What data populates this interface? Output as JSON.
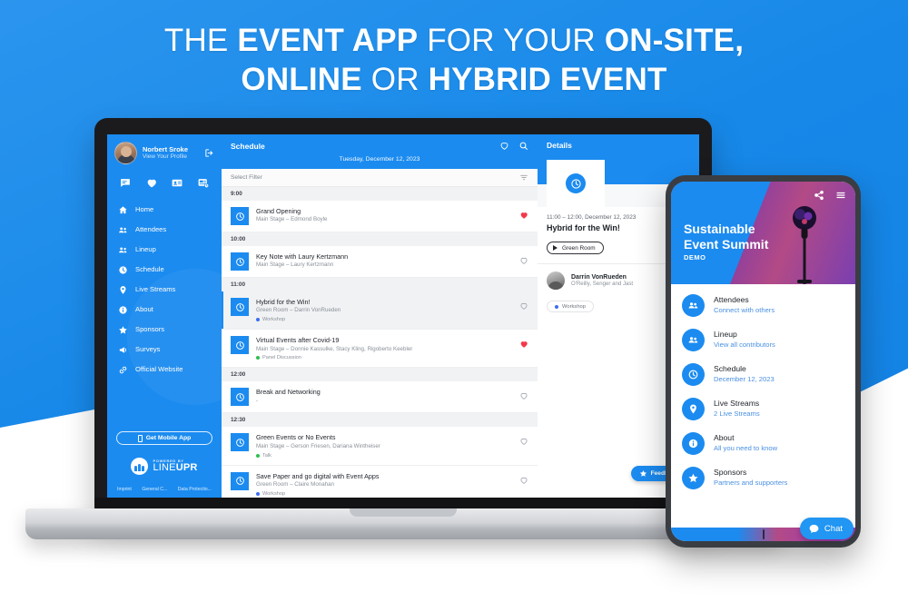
{
  "headline": {
    "line1_a": "THE ",
    "line1_b": "EVENT APP",
    "line1_c": " FOR YOUR ",
    "line1_d": "ON-SITE,",
    "line2_a": "ONLINE",
    "line2_b": " OR ",
    "line2_c": "HYBRID EVENT"
  },
  "colors": {
    "brand_blue": "#1b8bf0",
    "background_blue": "#1788e8",
    "heart_red": "#f3384a",
    "tag_blue": "#3d6ef0",
    "tag_green": "#2fbf4f",
    "link_blue": "#4a90e2"
  },
  "laptop": {
    "sidebar": {
      "profile": {
        "name": "Norbert Sroke",
        "subtitle": "View Your Profile",
        "logout_icon": "logout-icon",
        "avatar_icon": "avatar"
      },
      "quick_icons": [
        "chat-icon",
        "heart-icon",
        "contact-card-icon",
        "news-calendar-icon"
      ],
      "items": [
        {
          "label": "Home",
          "icon": "home-icon"
        },
        {
          "label": "Attendees",
          "icon": "people-icon"
        },
        {
          "label": "Lineup",
          "icon": "people-icon"
        },
        {
          "label": "Schedule",
          "icon": "clock-icon"
        },
        {
          "label": "Live Streams",
          "icon": "pin-icon"
        },
        {
          "label": "About",
          "icon": "info-icon"
        },
        {
          "label": "Sponsors",
          "icon": "star-icon"
        },
        {
          "label": "Surveys",
          "icon": "megaphone-icon"
        },
        {
          "label": "Official Website",
          "icon": "link-icon"
        }
      ],
      "mobile_app_button": "Get Mobile App",
      "brand": {
        "powered_by": "POWERED BY",
        "name_light": "LINE",
        "name_bold": "UPR"
      },
      "footer_links": [
        "Imprint",
        "General C...",
        "Data Protectio..."
      ]
    },
    "schedule": {
      "title": "Schedule",
      "header_icons": [
        "heart-icon",
        "search-icon"
      ],
      "date": "Tuesday, December 12, 2023",
      "filter_placeholder": "Select Filter",
      "filter_icon": "filter-icon",
      "groups": [
        {
          "time": "9:00",
          "events": [
            {
              "title": "Grand Opening",
              "meta": "Main Stage – Edmond Boyle",
              "tag": "",
              "tag_color": "",
              "favorited": true,
              "selected": false
            }
          ]
        },
        {
          "time": "10:00",
          "events": [
            {
              "title": "Key Note with Laury Kertzmann",
              "meta": "Main Stage – Laury Kertzmann",
              "tag": "",
              "tag_color": "",
              "favorited": false,
              "selected": false
            }
          ]
        },
        {
          "time": "11:00",
          "events": [
            {
              "title": "Hybrid for the Win!",
              "meta": "Green Room – Darrin VonRueden",
              "tag": "Workshop",
              "tag_color": "#3d6ef0",
              "favorited": false,
              "selected": true
            },
            {
              "title": "Virtual Events after Covid-19",
              "meta": "Main Stage – Donnie Kassulke, Stacy Kling, Rigoberto Keebler",
              "tag": "Panel Discussion",
              "tag_color": "#2fbf4f",
              "favorited": true,
              "selected": false
            }
          ]
        },
        {
          "time": "12:00",
          "events": [
            {
              "title": "Break and Networking",
              "meta": "-",
              "tag": "",
              "tag_color": "",
              "favorited": false,
              "selected": false
            }
          ]
        },
        {
          "time": "12:30",
          "events": [
            {
              "title": "Green Events or No Events",
              "meta": "Main Stage – Gerson Friesen, Dariana Wintheiser",
              "tag": "Talk",
              "tag_color": "#2fbf4f",
              "favorited": false,
              "selected": false
            },
            {
              "title": "Save Paper and go digital with Event Apps",
              "meta": "Green Room – Claire Monahan",
              "tag": "Workshop",
              "tag_color": "#3d6ef0",
              "favorited": false,
              "selected": false
            }
          ]
        }
      ]
    },
    "details": {
      "title": "Details",
      "hero_icon": "clock-icon",
      "calendar_icon": "calendar-add-icon",
      "time": "11:00 – 12:00, December 12, 2023",
      "event_title": "Hybrid for the Win!",
      "room": "Green Room",
      "room_icon": "play-icon",
      "speaker_name": "Darrin VonRueden",
      "speaker_company": "O'Reilly, Senger and Jast",
      "tag": "Workshop",
      "tag_color": "#3d6ef0"
    },
    "feedback_button": {
      "label": "Feedback",
      "icon": "star-icon"
    }
  },
  "phone": {
    "hero": {
      "share_icon": "share-icon",
      "menu_icon": "hamburger-menu-icon",
      "event_name": "Sustainable\nEvent Summit",
      "event_name_line1": "Sustainable",
      "event_name_line2": "Event Summit",
      "badge": "DEMO"
    },
    "menu": [
      {
        "label": "Attendees",
        "subtitle": "Connect with others",
        "icon": "people-icon"
      },
      {
        "label": "Lineup",
        "subtitle": "View all contributors",
        "icon": "people-icon"
      },
      {
        "label": "Schedule",
        "subtitle": "December 12, 2023",
        "icon": "clock-icon"
      },
      {
        "label": "Live Streams",
        "subtitle": "2 Live Streams",
        "icon": "pin-icon"
      },
      {
        "label": "About",
        "subtitle": "All you need to know",
        "icon": "info-icon"
      },
      {
        "label": "Sponsors",
        "subtitle": "Partners and supporters",
        "icon": "star-icon"
      }
    ],
    "chat_button": {
      "label": "Chat",
      "icon": "chat-bubble-icon"
    }
  }
}
